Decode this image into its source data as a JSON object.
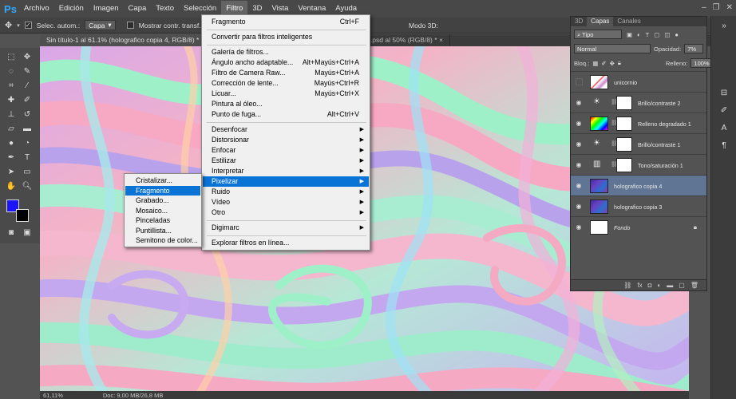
{
  "app": {
    "logo": "Ps"
  },
  "menubar": {
    "items": [
      "Archivo",
      "Edición",
      "Imagen",
      "Capa",
      "Texto",
      "Selección",
      "Filtro",
      "3D",
      "Vista",
      "Ventana",
      "Ayuda"
    ],
    "active": "Filtro",
    "window_controls": [
      "–",
      "❐",
      "✕"
    ]
  },
  "options": {
    "auto_select_label": "Selec. autom.:",
    "auto_select_value": "Capa",
    "transform_label": "Mostrar contr. transf.",
    "mode3d_label": "Modo 3D:"
  },
  "tabs": [
    {
      "label": "Sin título-1 al 61.1% (holografico copia 4, RGB/8) *",
      "close": "×"
    },
    {
      "label": "grafic_1.psd al 50% (RGB/8) *",
      "close": "×"
    }
  ],
  "filter_menu": {
    "items": [
      {
        "label": "Fragmento",
        "shortcut": "Ctrl+F"
      },
      {
        "label": "Convertir para filtros inteligentes",
        "shortcut": ""
      },
      {
        "label": "Galería de filtros...",
        "shortcut": ""
      },
      {
        "label": "Ángulo ancho adaptable...",
        "shortcut": "Alt+Mayús+Ctrl+A"
      },
      {
        "label": "Filtro de Camera Raw...",
        "shortcut": "Mayús+Ctrl+A"
      },
      {
        "label": "Corrección de lente...",
        "shortcut": "Mayús+Ctrl+R"
      },
      {
        "label": "Licuar...",
        "shortcut": "Mayús+Ctrl+X"
      },
      {
        "label": "Pintura al óleo...",
        "shortcut": ""
      },
      {
        "label": "Punto de fuga...",
        "shortcut": "Alt+Ctrl+V"
      },
      {
        "label": "Desenfocar",
        "shortcut": ""
      },
      {
        "label": "Distorsionar",
        "shortcut": ""
      },
      {
        "label": "Enfocar",
        "shortcut": ""
      },
      {
        "label": "Estilizar",
        "shortcut": ""
      },
      {
        "label": "Interpretar",
        "shortcut": ""
      },
      {
        "label": "Pixelizar",
        "shortcut": ""
      },
      {
        "label": "Ruido",
        "shortcut": ""
      },
      {
        "label": "Vídeo",
        "shortcut": ""
      },
      {
        "label": "Otro",
        "shortcut": ""
      },
      {
        "label": "Digimarc",
        "shortcut": ""
      },
      {
        "label": "Explorar filtros en línea...",
        "shortcut": ""
      }
    ],
    "submenu_arrow": "▶"
  },
  "pixelizar_submenu": {
    "items": [
      "Cristalizar...",
      "Fragmento",
      "Grabado...",
      "Mosaico...",
      "Pinceladas",
      "Puntillista...",
      "Semitono de color..."
    ],
    "highlighted": "Fragmento"
  },
  "layers_panel": {
    "tabs": [
      "3D",
      "Capas",
      "Canales"
    ],
    "active_tab": "Capas",
    "filter_kind": "Tipo",
    "blend_mode": "Normal",
    "opacity_label": "Opacidad:",
    "opacity_value": "7%",
    "lock_label": "Bloq.:",
    "fill_label": "Relleno:",
    "fill_value": "100%",
    "layers": [
      {
        "name": "unicornio",
        "visible": false
      },
      {
        "name": "Brillo/contraste 2",
        "visible": true
      },
      {
        "name": "Relleno degradado 1",
        "visible": true
      },
      {
        "name": "Brillo/contraste 1",
        "visible": true
      },
      {
        "name": "Tono/saturación 1",
        "visible": true
      },
      {
        "name": "holografico copia 4",
        "visible": true,
        "selected": true
      },
      {
        "name": "holografico copia 3",
        "visible": true
      },
      {
        "name": "Fondo",
        "visible": true,
        "locked": true
      }
    ],
    "footer_icons": [
      "link-icon",
      "fx-icon",
      "mask-icon",
      "adjustment-icon",
      "folder-icon",
      "new-layer-icon",
      "trash-icon"
    ]
  },
  "status": {
    "zoom": "61,11%",
    "doc": "Doc: 9,00 MB/26,8 MB"
  },
  "colors": {
    "foreground": "#1b14ff",
    "background": "#000000",
    "highlight": "#0a74d6"
  }
}
